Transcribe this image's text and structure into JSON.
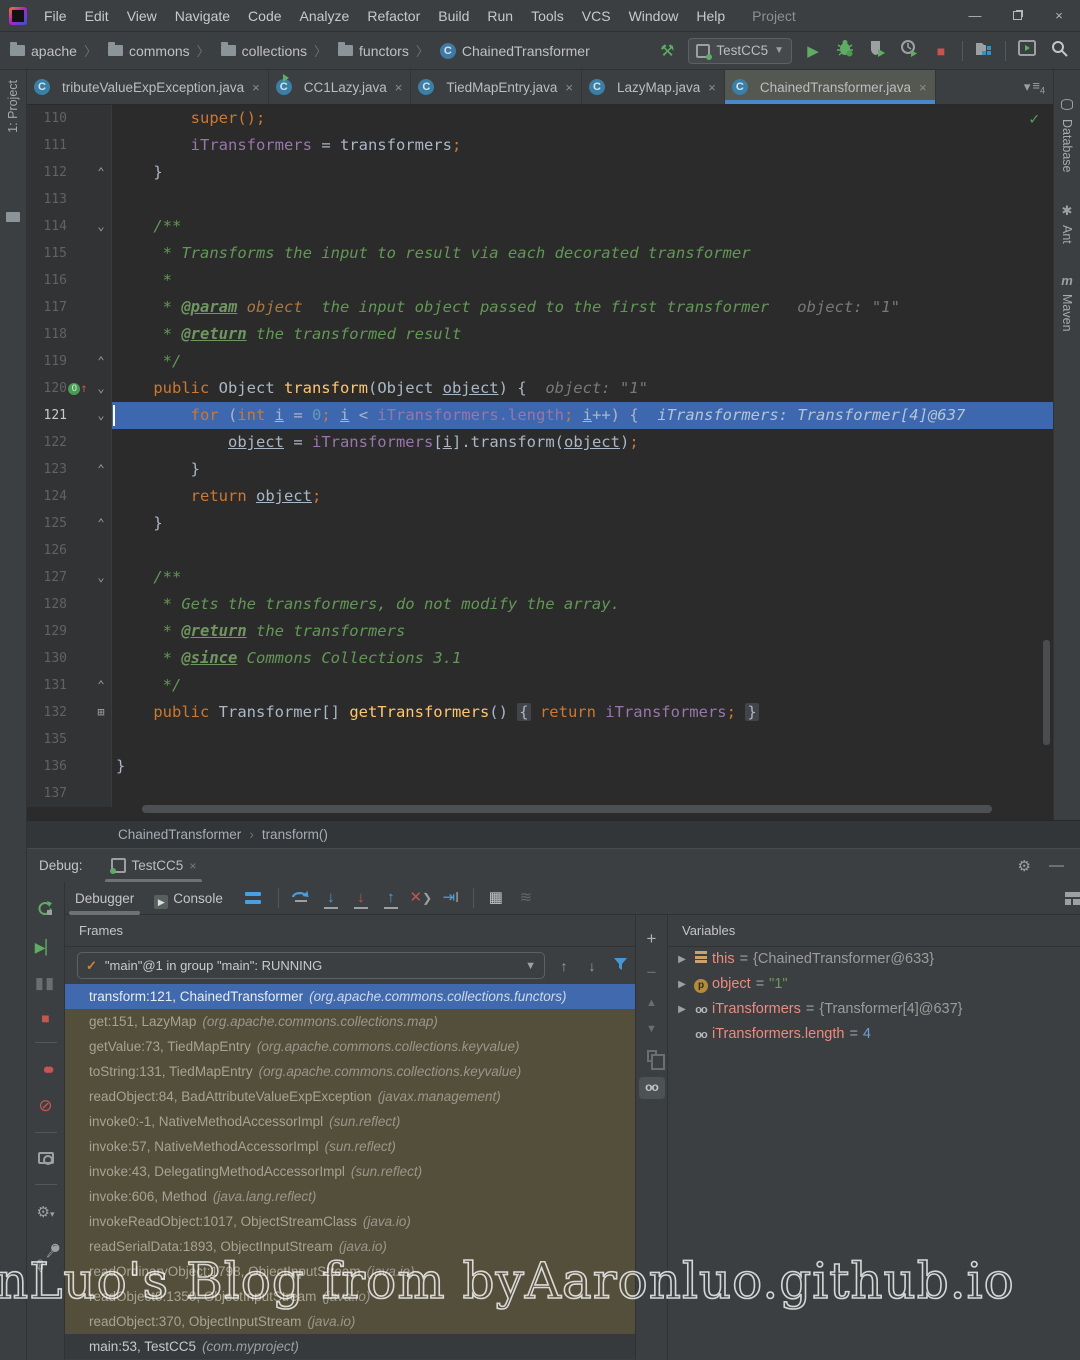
{
  "titlebar": {
    "menus": [
      "File",
      "Edit",
      "View",
      "Navigate",
      "Code",
      "Analyze",
      "Refactor",
      "Build",
      "Run",
      "Tools",
      "VCS",
      "Window",
      "Help"
    ],
    "project_label": "Project",
    "window_buttons": {
      "minimize": "—",
      "restore": "",
      "close": "×"
    }
  },
  "toolbar": {
    "breadcrumb_folders": [
      "apache",
      "commons",
      "collections",
      "functors"
    ],
    "breadcrumb_class": "ChainedTransformer",
    "run_config": "TestCC5",
    "icons": [
      "build-hammer",
      "run",
      "debug-bug",
      "coverage-shield",
      "profiler-clock",
      "stop",
      "project-structure",
      "run-window",
      "search"
    ]
  },
  "side_left": {
    "label": "1: Project"
  },
  "side_right": {
    "items": [
      "Database",
      "Ant",
      "Maven"
    ]
  },
  "tabs": [
    {
      "label": "tributeValueExpException.java",
      "runnable": false,
      "active": false
    },
    {
      "label": "CC1Lazy.java",
      "runnable": true,
      "active": false
    },
    {
      "label": "TiedMapEntry.java",
      "runnable": false,
      "active": false
    },
    {
      "label": "LazyMap.java",
      "runnable": false,
      "active": false
    },
    {
      "label": "ChainedTransformer.java",
      "runnable": false,
      "active": true
    }
  ],
  "editor": {
    "inspection_check": "✓",
    "breadcrumb": {
      "class": "ChainedTransformer",
      "method": "transform()"
    },
    "lines": [
      {
        "n": "110",
        "mark": "",
        "tokens": [
          [
            "t",
            "        "
          ],
          [
            "k",
            "super();"
          ]
        ]
      },
      {
        "n": "111",
        "mark": "",
        "tokens": [
          [
            "t",
            "        "
          ],
          [
            "f",
            "iTransformers"
          ],
          [
            "t",
            " = transformers"
          ],
          [
            "k",
            ";"
          ]
        ]
      },
      {
        "n": "112",
        "mark": "up",
        "tokens": [
          [
            "t",
            "    }"
          ]
        ]
      },
      {
        "n": "113",
        "mark": "",
        "tokens": []
      },
      {
        "n": "114",
        "mark": "down",
        "tokens": [
          [
            "c",
            "    /**"
          ]
        ]
      },
      {
        "n": "115",
        "mark": "",
        "tokens": [
          [
            "c",
            "     * Transforms the input to result via each decorated transformer"
          ]
        ]
      },
      {
        "n": "116",
        "mark": "",
        "tokens": [
          [
            "c",
            "     *"
          ]
        ]
      },
      {
        "n": "117",
        "mark": "",
        "tokens": [
          [
            "c",
            "     * "
          ],
          [
            "d",
            "@param"
          ],
          [
            "p",
            " object"
          ],
          [
            "c",
            "  the input object passed to the first transformer"
          ],
          [
            "h",
            "   object: \"1\""
          ]
        ]
      },
      {
        "n": "118",
        "mark": "",
        "tokens": [
          [
            "c",
            "     * "
          ],
          [
            "d",
            "@return"
          ],
          [
            "c",
            " the transformed result"
          ]
        ]
      },
      {
        "n": "119",
        "mark": "up",
        "tokens": [
          [
            "c",
            "     */"
          ]
        ]
      },
      {
        "n": "120",
        "mark": "down",
        "override": true,
        "tokens": [
          [
            "k",
            "    public "
          ],
          [
            "t",
            "Object "
          ],
          [
            "m",
            "transform"
          ],
          [
            "t",
            "(Object "
          ],
          [
            "u",
            "object"
          ],
          [
            "t",
            ") {  "
          ],
          [
            "h",
            "object: \"1\""
          ]
        ]
      },
      {
        "n": "121",
        "mark": "down",
        "current": true,
        "tokens": [
          [
            "k",
            "        for "
          ],
          [
            "t",
            "("
          ],
          [
            "k",
            "int "
          ],
          [
            "u",
            "i"
          ],
          [
            "t",
            " = "
          ],
          [
            "n",
            "0"
          ],
          [
            "k",
            "; "
          ],
          [
            "u",
            "i"
          ],
          [
            "t",
            " < "
          ],
          [
            "f",
            "iTransformers.length"
          ],
          [
            "k",
            "; "
          ],
          [
            "u",
            "i"
          ],
          [
            "t",
            "++) {  "
          ],
          [
            "hb",
            "iTransformers: Transformer[4]@637"
          ]
        ]
      },
      {
        "n": "122",
        "mark": "",
        "tokens": [
          [
            "t",
            "            "
          ],
          [
            "u",
            "object"
          ],
          [
            "t",
            " = "
          ],
          [
            "f",
            "iTransformers"
          ],
          [
            "t",
            "["
          ],
          [
            "u",
            "i"
          ],
          [
            "t",
            "].transform("
          ],
          [
            "u",
            "object"
          ],
          [
            "t",
            ")"
          ],
          [
            "k",
            ";"
          ]
        ]
      },
      {
        "n": "123",
        "mark": "up",
        "tokens": [
          [
            "t",
            "        }"
          ]
        ]
      },
      {
        "n": "124",
        "mark": "",
        "tokens": [
          [
            "t",
            "        "
          ],
          [
            "k",
            "return "
          ],
          [
            "u",
            "object"
          ],
          [
            "k",
            ";"
          ]
        ]
      },
      {
        "n": "125",
        "mark": "up",
        "tokens": [
          [
            "t",
            "    }"
          ]
        ]
      },
      {
        "n": "126",
        "mark": "",
        "tokens": []
      },
      {
        "n": "127",
        "mark": "down",
        "tokens": [
          [
            "c",
            "    /**"
          ]
        ]
      },
      {
        "n": "128",
        "mark": "",
        "tokens": [
          [
            "c",
            "     * Gets the transformers, do not modify the array."
          ]
        ]
      },
      {
        "n": "129",
        "mark": "",
        "tokens": [
          [
            "c",
            "     * "
          ],
          [
            "d",
            "@return"
          ],
          [
            "c",
            " the transformers"
          ]
        ]
      },
      {
        "n": "130",
        "mark": "",
        "tokens": [
          [
            "c",
            "     * "
          ],
          [
            "d",
            "@since"
          ],
          [
            "c",
            " Commons Collections 3.1"
          ]
        ]
      },
      {
        "n": "131",
        "mark": "up",
        "tokens": [
          [
            "c",
            "     */"
          ]
        ]
      },
      {
        "n": "132",
        "mark": "box",
        "tokens": [
          [
            "k",
            "    public "
          ],
          [
            "t",
            "Transformer[] "
          ],
          [
            "m",
            "getTransformers"
          ],
          [
            "t",
            "() "
          ],
          [
            "fb",
            "{"
          ],
          [
            "k",
            " return "
          ],
          [
            "f",
            "iTransformers"
          ],
          [
            "k",
            ";"
          ],
          [
            "t",
            " "
          ],
          [
            "fb",
            "}"
          ]
        ]
      },
      {
        "n": "135",
        "mark": "",
        "tokens": []
      },
      {
        "n": "136",
        "mark": "",
        "tokens": [
          [
            "t",
            "}"
          ]
        ]
      },
      {
        "n": "137",
        "mark": "",
        "tokens": []
      }
    ]
  },
  "debug": {
    "label": "Debug:",
    "session_tab": "TestCC5",
    "tool_tabs": [
      {
        "label": "Debugger",
        "selected": true
      },
      {
        "label": "Console",
        "selected": false
      }
    ],
    "frames": {
      "title": "Frames",
      "thread": "\"main\"@1 in group \"main\": RUNNING",
      "items": [
        {
          "m": "transform:121, ChainedTransformer",
          "p": "(org.apache.commons.collections.functors)",
          "state": "sel"
        },
        {
          "m": "get:151, LazyMap",
          "p": "(org.apache.commons.collections.map)",
          "state": "lib"
        },
        {
          "m": "getValue:73, TiedMapEntry",
          "p": "(org.apache.commons.collections.keyvalue)",
          "state": "lib"
        },
        {
          "m": "toString:131, TiedMapEntry",
          "p": "(org.apache.commons.collections.keyvalue)",
          "state": "lib"
        },
        {
          "m": "readObject:84, BadAttributeValueExpException",
          "p": "(javax.management)",
          "state": "lib"
        },
        {
          "m": "invoke0:-1, NativeMethodAccessorImpl",
          "p": "(sun.reflect)",
          "state": "lib"
        },
        {
          "m": "invoke:57, NativeMethodAccessorImpl",
          "p": "(sun.reflect)",
          "state": "lib"
        },
        {
          "m": "invoke:43, DelegatingMethodAccessorImpl",
          "p": "(sun.reflect)",
          "state": "lib"
        },
        {
          "m": "invoke:606, Method",
          "p": "(java.lang.reflect)",
          "state": "lib"
        },
        {
          "m": "invokeReadObject:1017, ObjectStreamClass",
          "p": "(java.io)",
          "state": "lib"
        },
        {
          "m": "readSerialData:1893, ObjectInputStream",
          "p": "(java.io)",
          "state": "lib"
        },
        {
          "m": "readOrdinaryObject:1798, ObjectInputStream",
          "p": "(java.io)",
          "state": "lib"
        },
        {
          "m": "readObject0:1350, ObjectInputStream",
          "p": "(java.io)",
          "state": "lib"
        },
        {
          "m": "readObject:370, ObjectInputStream",
          "p": "(java.io)",
          "state": "lib"
        },
        {
          "m": "main:53, TestCC5",
          "p": "(com.myproject)",
          "state": "dark"
        }
      ]
    },
    "variables": {
      "title": "Variables",
      "items": [
        {
          "icon": "this",
          "expand": true,
          "name": "this",
          "value": "{ChainedTransformer@633}",
          "vtype": "ref"
        },
        {
          "icon": "param",
          "expand": true,
          "name": "object",
          "value": "\"1\"",
          "vtype": "str"
        },
        {
          "icon": "watch",
          "expand": true,
          "name": "iTransformers",
          "value": "{Transformer[4]@637}",
          "vtype": "ref"
        },
        {
          "icon": "watch",
          "expand": false,
          "name": "iTransformers.length",
          "value": "4",
          "vtype": "num"
        }
      ]
    }
  },
  "watermark": "nLuo's Blog from  byAaronluo.github.io"
}
